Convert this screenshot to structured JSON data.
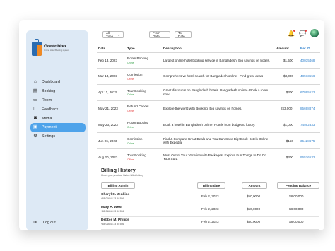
{
  "brand": {
    "name": "Gontobbo",
    "tagline": "Online Hotel Booking system"
  },
  "sidebar": {
    "items": [
      {
        "label": "Dashboard",
        "icon": "home-icon"
      },
      {
        "label": "Booking",
        "icon": "booking-icon"
      },
      {
        "label": "Room",
        "icon": "bed-icon"
      },
      {
        "label": "Feedback",
        "icon": "feedback-icon"
      },
      {
        "label": "Media",
        "icon": "media-icon"
      },
      {
        "label": "Payment",
        "icon": "wallet-icon",
        "active": true
      },
      {
        "label": "Settings",
        "icon": "gear-icon"
      }
    ],
    "logout_label": "Log out"
  },
  "filters": {
    "range": "All Time",
    "from": "From Date",
    "to": "To Date"
  },
  "table": {
    "headers": {
      "date": "Date",
      "type": "Type",
      "description": "Description",
      "amount": "Amount",
      "ref": "Ref ID"
    },
    "rows": [
      {
        "date": "Feb 13, 2023",
        "type": "Room Booking",
        "status": "Online",
        "status_kind": "online",
        "description": "Largest online hotel booking service in Bangladesh. Big savings on hotels.",
        "amount": "$1,500",
        "ref": "40035468"
      },
      {
        "date": "Mar 13, 2023",
        "type": "Comission",
        "status": "Offline",
        "status_kind": "offline",
        "description": "Comprehensive hotel search for Bangladesh online · Find great deals",
        "amount": "$3,000",
        "ref": "48573556"
      },
      {
        "date": "Apr 11, 2023",
        "type": "Tour Booking",
        "status": "Online",
        "status_kind": "online",
        "description": "Great discounts on Bangladesh hotels. Bangladesh online · Book a room now.",
        "amount": "$300",
        "ref": "67865522"
      },
      {
        "date": "May 21, 2023",
        "type": "Refund Cancel",
        "status": "Offline",
        "status_kind": "offline",
        "description": "Explore the world with Booking. Big savings on homes.",
        "amount": "($3,000)",
        "ref": "85698874"
      },
      {
        "date": "May 23, 2023",
        "type": "Room Booking",
        "status": "Online",
        "status_kind": "online",
        "description": "Book a hotel in Bangladesh online. Hotels from budget to luxury.",
        "amount": "$1,000",
        "ref": "74562333"
      },
      {
        "date": "Jun 06, 2023",
        "type": "Comission",
        "status": "Online",
        "status_kind": "online",
        "description": "Find & Compare Great Deals and You Can Save Big! Book Hotels Online with Expedia.",
        "amount": "$150",
        "ref": "35428675"
      },
      {
        "date": "Aug 20, 2023",
        "type": "Tour Booking",
        "status": "Offline",
        "status_kind": "offline",
        "description": "Must Out of Your Vacation with Packages. Explore Fun Things to Do On Your Stay.",
        "amount": "$300",
        "ref": "96576532"
      }
    ]
  },
  "billing": {
    "title": "Billing History",
    "subtitle": "Check your previous history billed history",
    "headers": {
      "admin": "Billing Admin",
      "date": "Billing date",
      "amount": "Amount",
      "balance": "Pending Balance"
    },
    "rows": [
      {
        "name": "Cheryl C. Jenkins",
        "phone": "+88 016 44 23 34 556",
        "date": "Feb 2, 2023",
        "amount": "$50,0000",
        "balance": "$8,00,000"
      },
      {
        "name": "Mary A. West",
        "phone": "+88 016 44 23 34 556",
        "date": "Feb 2, 2023",
        "amount": "$50,0000",
        "balance": "$8,00,000"
      },
      {
        "name": "Debbie M. Philips",
        "phone": "+88 016 44 23 34 556",
        "date": "Feb 2, 2023",
        "amount": "$50,0000",
        "balance": "$8,00,000"
      }
    ]
  },
  "colors": {
    "accent": "#4ea3ea",
    "sidebar_bg": "#dde9f5",
    "link": "#3182ce",
    "online": "#2f9e44",
    "offline": "#e53e3e"
  }
}
